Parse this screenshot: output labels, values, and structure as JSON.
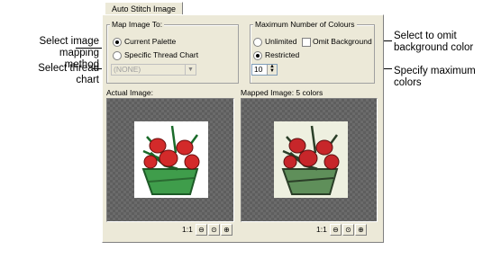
{
  "dialog": {
    "tab_label": "Auto Stitch Image",
    "map_group": {
      "title": "Map Image To:",
      "option_current": "Current Palette",
      "option_specific": "Specific Thread Chart",
      "thread_chart_value": "(NONE)"
    },
    "colours_group": {
      "title": "Maximum Number of Colours",
      "option_unlimited": "Unlimited",
      "omit_background": "Omit Background",
      "option_restricted": "Restricted",
      "max_colours_value": "10"
    },
    "actual_label": "Actual Image:",
    "mapped_label": "Mapped Image: 5 colors",
    "zoom_ratio": "1:1"
  },
  "callouts": {
    "mapping_method": [
      "Select image",
      "mapping method"
    ],
    "thread_chart": [
      "Select thread",
      "chart"
    ],
    "omit_background": [
      "Select to omit",
      "background color"
    ],
    "max_colors": [
      "Specify maximum",
      "colors"
    ]
  },
  "icons": {
    "zoom_out": "magnifier-minus-icon",
    "zoom_fit": "magnifier-icon",
    "zoom_in": "magnifier-plus-icon"
  },
  "colors": {
    "dialog_bg": "#ece9d8",
    "preview_bg": "#6b6b6b",
    "flower_red": "#d32a2a",
    "leaf_green": "#2f8f3f"
  }
}
